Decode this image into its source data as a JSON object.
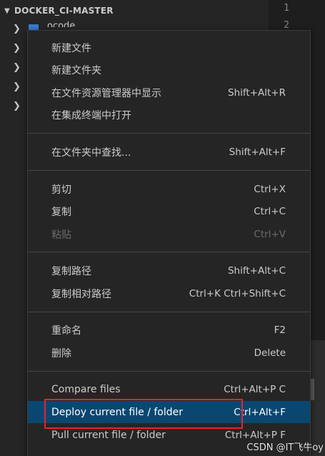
{
  "explorer": {
    "title": "DOCKER_CI-MASTER",
    "folder_peek_label": "ocode"
  },
  "editor": {
    "line_numbers": [
      "1",
      "2"
    ],
    "bottom_peek": "[...]"
  },
  "context_menu": {
    "items": [
      {
        "label": "新建文件",
        "shortcut": ""
      },
      {
        "label": "新建文件夹",
        "shortcut": ""
      },
      {
        "label": "在文件资源管理器中显示",
        "shortcut": "Shift+Alt+R"
      },
      {
        "label": "在集成终端中打开",
        "shortcut": ""
      },
      {
        "label": "在文件夹中查找...",
        "shortcut": "Shift+Alt+F"
      },
      {
        "label": "剪切",
        "shortcut": "Ctrl+X"
      },
      {
        "label": "复制",
        "shortcut": "Ctrl+C"
      },
      {
        "label": "粘贴",
        "shortcut": "Ctrl+V",
        "disabled": true
      },
      {
        "label": "复制路径",
        "shortcut": "Shift+Alt+C"
      },
      {
        "label": "复制相对路径",
        "shortcut": "Ctrl+K Ctrl+Shift+C"
      },
      {
        "label": "重命名",
        "shortcut": "F2"
      },
      {
        "label": "删除",
        "shortcut": "Delete"
      },
      {
        "label": "Compare files",
        "shortcut": "Ctrl+Alt+P C"
      },
      {
        "label": "Deploy current file / folder",
        "shortcut": "Ctrl+Alt+F",
        "active": true
      },
      {
        "label": "Pull current file / folder",
        "shortcut": "Ctrl+Alt+P F"
      }
    ]
  },
  "watermark": "CSDN @IT飞牛oy",
  "colors": {
    "menu_bg": "#252526",
    "active_bg": "#094771",
    "highlight_border": "#e3242b",
    "text": "#cccccc",
    "disabled_text": "#6b6b6b"
  }
}
